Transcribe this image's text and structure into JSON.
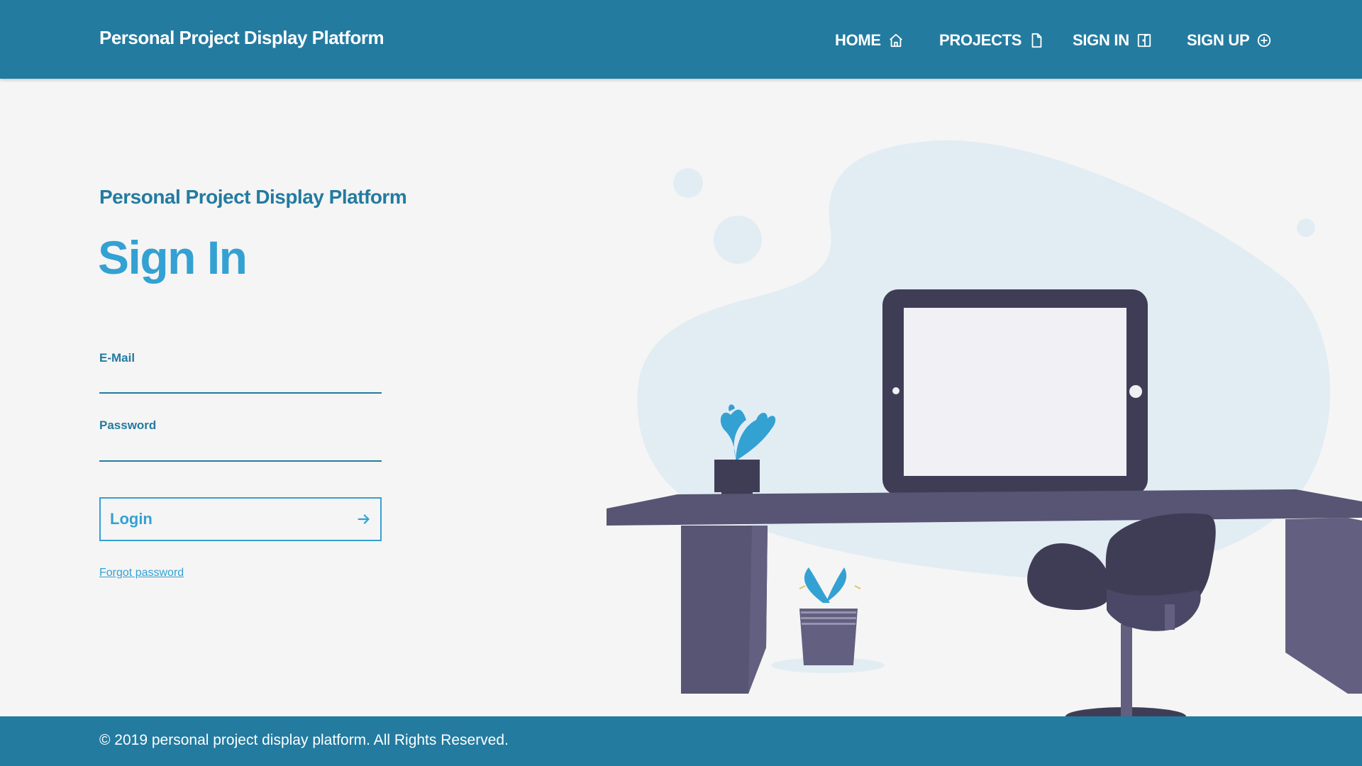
{
  "header": {
    "brand": "Personal Project Display Platform",
    "nav": [
      {
        "label": "HOME",
        "icon": "home-icon"
      },
      {
        "label": "PROJECTS",
        "icon": "file-icon"
      },
      {
        "label": "SIGN IN",
        "icon": "sign-in-icon"
      },
      {
        "label": "SIGN UP",
        "icon": "plus-circle-icon"
      }
    ]
  },
  "main": {
    "subtitle": "Personal Project Display Platform",
    "title": "Sign In",
    "email_label": "E-Mail",
    "email_value": "",
    "password_label": "Password",
    "password_value": "",
    "login_label": "Login",
    "login_icon": "arrow-right-icon",
    "forgot_label": "Forgot password"
  },
  "footer": {
    "copyright": "© 2019 personal project display platform. All Rights Reserved."
  },
  "colors": {
    "primary": "#237ba0",
    "accent": "#34a1d3",
    "background": "#f5f5f5",
    "illustration_dark": "#3f3d56",
    "illustration_blob": "#e2edf3"
  }
}
